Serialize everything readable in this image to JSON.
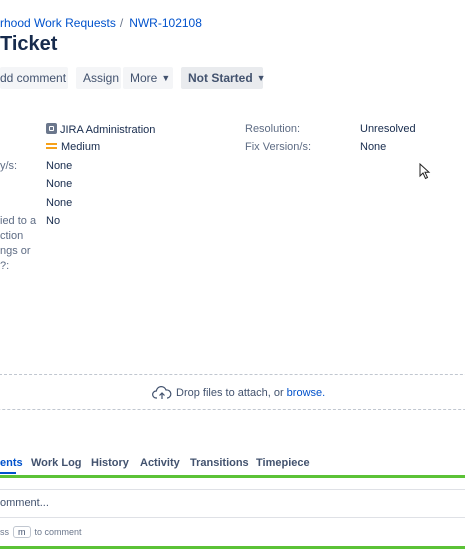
{
  "breadcrumb": {
    "project": "rhood Work Requests",
    "separator": "/",
    "issue_key": "NWR-102108"
  },
  "title": "Ticket",
  "toolbar": {
    "add_comment": "dd comment",
    "assign": "Assign",
    "more": "More",
    "status": "Not Started"
  },
  "details": {
    "left_labels": [
      "y/s:",
      "ied to a",
      "ction",
      "ngs or",
      "?:"
    ],
    "component_value": "JIRA Administration",
    "priority_value": "Medium",
    "none_1": "None",
    "none_2": "None",
    "none_3": "None",
    "applied_value": "No",
    "resolution_label": "Resolution:",
    "resolution_value": "Unresolved",
    "fix_version_label": "Fix Version/s:",
    "fix_version_value": "None"
  },
  "drop_zone": {
    "text": "Drop files to attach, or",
    "link": "browse."
  },
  "tabs": {
    "comments": "ents",
    "work_log": "Work Log",
    "history": "History",
    "activity": "Activity",
    "transitions": "Transitions",
    "timepiece": "Timepiece"
  },
  "comment": {
    "placeholder": "omment...",
    "hint_prefix": "ss",
    "hint_key": "m",
    "hint_suffix": "to comment"
  },
  "icons": {
    "component": "jira-admin-icon",
    "priority": "priority-medium-icon",
    "upload": "cloud-upload-icon",
    "cursor": "mouse-pointer-icon"
  },
  "colors": {
    "link": "#0052cc",
    "priority_medium": "#f6a11a",
    "active_bar": "#5bc236"
  }
}
